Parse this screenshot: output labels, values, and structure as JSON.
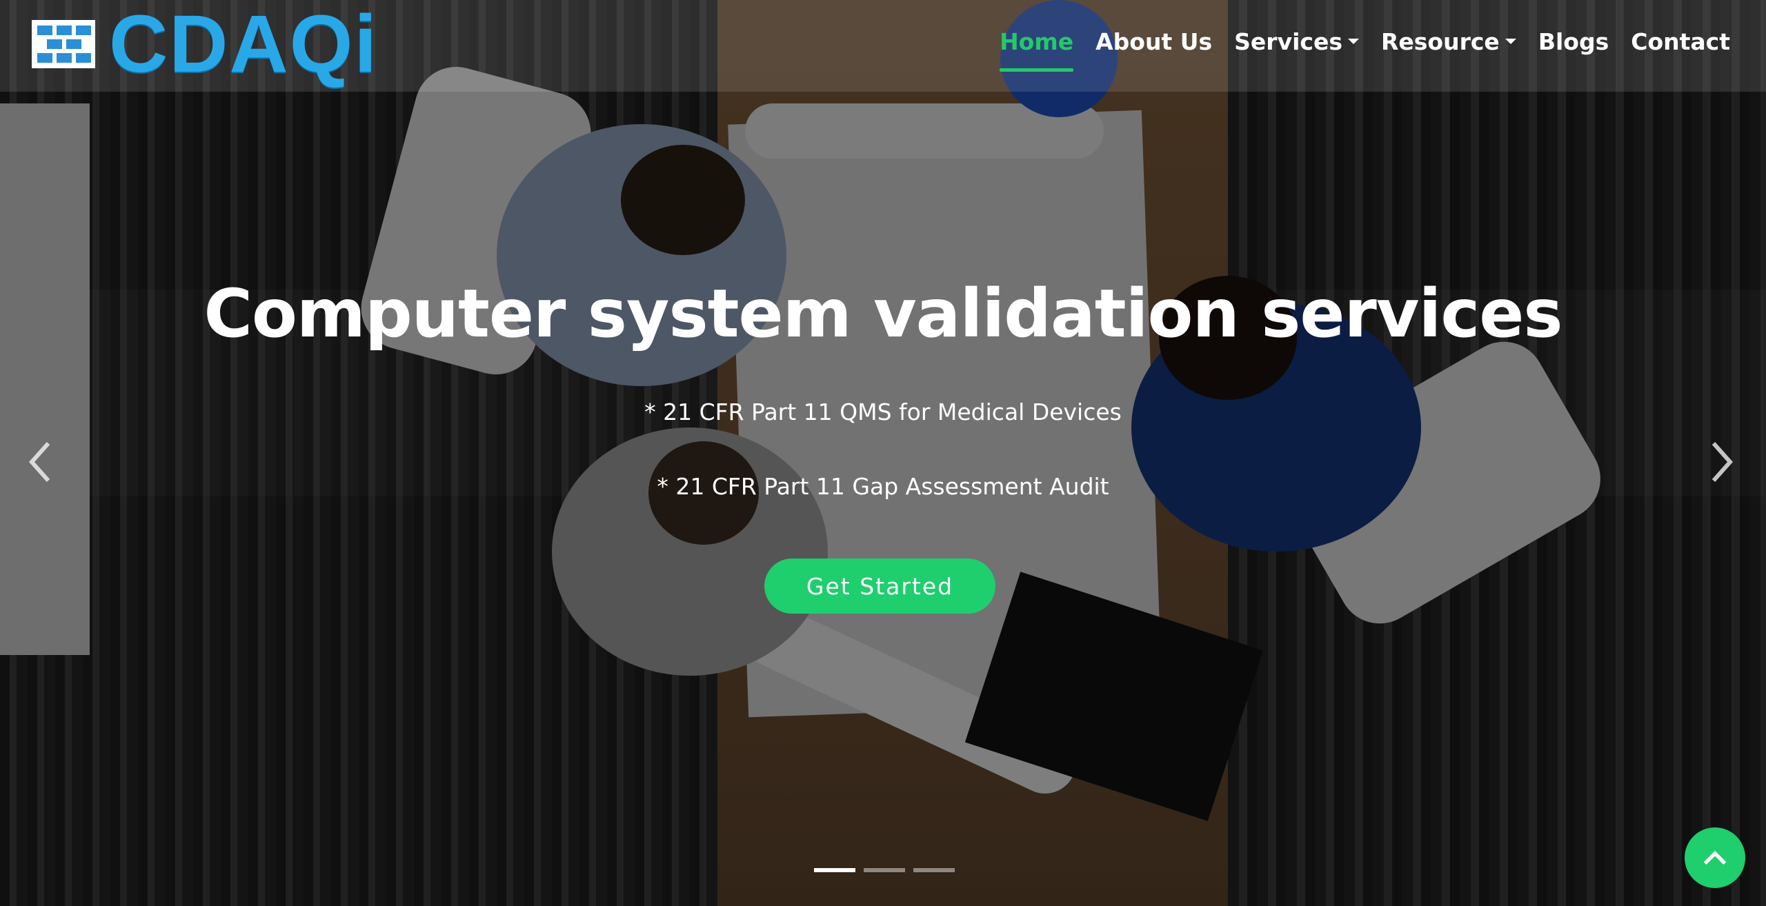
{
  "brand": {
    "logo_text": "CDAQi",
    "logo_color": "#29a8e8"
  },
  "nav": {
    "items": [
      {
        "label": "Home",
        "active": true
      },
      {
        "label": "About Us"
      },
      {
        "label": "Services",
        "dropdown": true
      },
      {
        "label": "Resource",
        "dropdown": true
      },
      {
        "label": "Blogs"
      },
      {
        "label": "Contact"
      }
    ],
    "accent_color": "#23c96b"
  },
  "hero": {
    "title": "Computer system validation services",
    "lines": [
      "* 21 CFR Part 11 QMS for Medical Devices",
      "* 21 CFR Part 11 Gap Assessment Audit"
    ],
    "cta_label": "Get Started",
    "prev_icon": "chevron-left-icon",
    "next_icon": "chevron-right-icon"
  },
  "carousel": {
    "slide_count": 3,
    "active_index": 0
  },
  "back_to_top": {
    "icon": "chevron-up-icon",
    "color": "#1fce6d"
  }
}
